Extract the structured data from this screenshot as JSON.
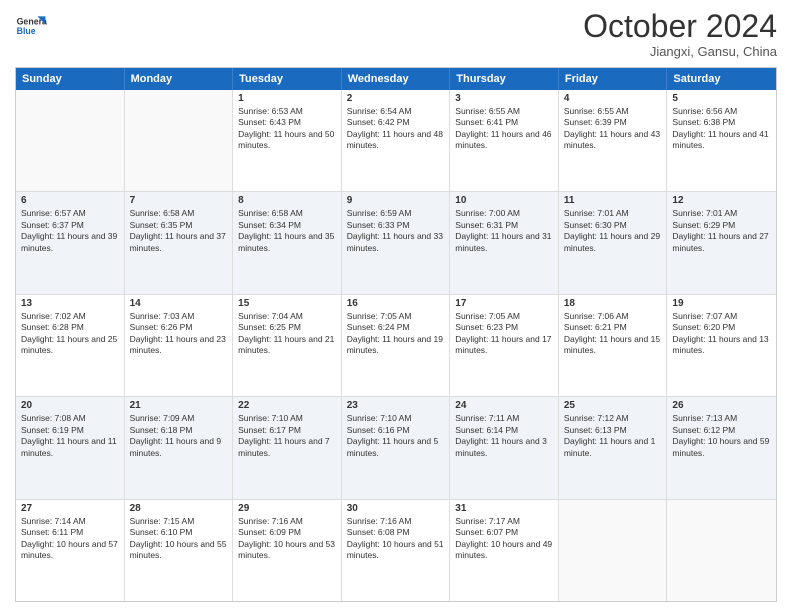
{
  "header": {
    "logo_line1": "General",
    "logo_line2": "Blue",
    "month": "October 2024",
    "location": "Jiangxi, Gansu, China"
  },
  "days_of_week": [
    "Sunday",
    "Monday",
    "Tuesday",
    "Wednesday",
    "Thursday",
    "Friday",
    "Saturday"
  ],
  "weeks": [
    [
      {
        "day": "",
        "sunrise": "",
        "sunset": "",
        "daylight": "",
        "empty": true
      },
      {
        "day": "",
        "sunrise": "",
        "sunset": "",
        "daylight": "",
        "empty": true
      },
      {
        "day": "1",
        "sunrise": "Sunrise: 6:53 AM",
        "sunset": "Sunset: 6:43 PM",
        "daylight": "Daylight: 11 hours and 50 minutes."
      },
      {
        "day": "2",
        "sunrise": "Sunrise: 6:54 AM",
        "sunset": "Sunset: 6:42 PM",
        "daylight": "Daylight: 11 hours and 48 minutes."
      },
      {
        "day": "3",
        "sunrise": "Sunrise: 6:55 AM",
        "sunset": "Sunset: 6:41 PM",
        "daylight": "Daylight: 11 hours and 46 minutes."
      },
      {
        "day": "4",
        "sunrise": "Sunrise: 6:55 AM",
        "sunset": "Sunset: 6:39 PM",
        "daylight": "Daylight: 11 hours and 43 minutes."
      },
      {
        "day": "5",
        "sunrise": "Sunrise: 6:56 AM",
        "sunset": "Sunset: 6:38 PM",
        "daylight": "Daylight: 11 hours and 41 minutes."
      }
    ],
    [
      {
        "day": "6",
        "sunrise": "Sunrise: 6:57 AM",
        "sunset": "Sunset: 6:37 PM",
        "daylight": "Daylight: 11 hours and 39 minutes."
      },
      {
        "day": "7",
        "sunrise": "Sunrise: 6:58 AM",
        "sunset": "Sunset: 6:35 PM",
        "daylight": "Daylight: 11 hours and 37 minutes."
      },
      {
        "day": "8",
        "sunrise": "Sunrise: 6:58 AM",
        "sunset": "Sunset: 6:34 PM",
        "daylight": "Daylight: 11 hours and 35 minutes."
      },
      {
        "day": "9",
        "sunrise": "Sunrise: 6:59 AM",
        "sunset": "Sunset: 6:33 PM",
        "daylight": "Daylight: 11 hours and 33 minutes."
      },
      {
        "day": "10",
        "sunrise": "Sunrise: 7:00 AM",
        "sunset": "Sunset: 6:31 PM",
        "daylight": "Daylight: 11 hours and 31 minutes."
      },
      {
        "day": "11",
        "sunrise": "Sunrise: 7:01 AM",
        "sunset": "Sunset: 6:30 PM",
        "daylight": "Daylight: 11 hours and 29 minutes."
      },
      {
        "day": "12",
        "sunrise": "Sunrise: 7:01 AM",
        "sunset": "Sunset: 6:29 PM",
        "daylight": "Daylight: 11 hours and 27 minutes."
      }
    ],
    [
      {
        "day": "13",
        "sunrise": "Sunrise: 7:02 AM",
        "sunset": "Sunset: 6:28 PM",
        "daylight": "Daylight: 11 hours and 25 minutes."
      },
      {
        "day": "14",
        "sunrise": "Sunrise: 7:03 AM",
        "sunset": "Sunset: 6:26 PM",
        "daylight": "Daylight: 11 hours and 23 minutes."
      },
      {
        "day": "15",
        "sunrise": "Sunrise: 7:04 AM",
        "sunset": "Sunset: 6:25 PM",
        "daylight": "Daylight: 11 hours and 21 minutes."
      },
      {
        "day": "16",
        "sunrise": "Sunrise: 7:05 AM",
        "sunset": "Sunset: 6:24 PM",
        "daylight": "Daylight: 11 hours and 19 minutes."
      },
      {
        "day": "17",
        "sunrise": "Sunrise: 7:05 AM",
        "sunset": "Sunset: 6:23 PM",
        "daylight": "Daylight: 11 hours and 17 minutes."
      },
      {
        "day": "18",
        "sunrise": "Sunrise: 7:06 AM",
        "sunset": "Sunset: 6:21 PM",
        "daylight": "Daylight: 11 hours and 15 minutes."
      },
      {
        "day": "19",
        "sunrise": "Sunrise: 7:07 AM",
        "sunset": "Sunset: 6:20 PM",
        "daylight": "Daylight: 11 hours and 13 minutes."
      }
    ],
    [
      {
        "day": "20",
        "sunrise": "Sunrise: 7:08 AM",
        "sunset": "Sunset: 6:19 PM",
        "daylight": "Daylight: 11 hours and 11 minutes."
      },
      {
        "day": "21",
        "sunrise": "Sunrise: 7:09 AM",
        "sunset": "Sunset: 6:18 PM",
        "daylight": "Daylight: 11 hours and 9 minutes."
      },
      {
        "day": "22",
        "sunrise": "Sunrise: 7:10 AM",
        "sunset": "Sunset: 6:17 PM",
        "daylight": "Daylight: 11 hours and 7 minutes."
      },
      {
        "day": "23",
        "sunrise": "Sunrise: 7:10 AM",
        "sunset": "Sunset: 6:16 PM",
        "daylight": "Daylight: 11 hours and 5 minutes."
      },
      {
        "day": "24",
        "sunrise": "Sunrise: 7:11 AM",
        "sunset": "Sunset: 6:14 PM",
        "daylight": "Daylight: 11 hours and 3 minutes."
      },
      {
        "day": "25",
        "sunrise": "Sunrise: 7:12 AM",
        "sunset": "Sunset: 6:13 PM",
        "daylight": "Daylight: 11 hours and 1 minute."
      },
      {
        "day": "26",
        "sunrise": "Sunrise: 7:13 AM",
        "sunset": "Sunset: 6:12 PM",
        "daylight": "Daylight: 10 hours and 59 minutes."
      }
    ],
    [
      {
        "day": "27",
        "sunrise": "Sunrise: 7:14 AM",
        "sunset": "Sunset: 6:11 PM",
        "daylight": "Daylight: 10 hours and 57 minutes."
      },
      {
        "day": "28",
        "sunrise": "Sunrise: 7:15 AM",
        "sunset": "Sunset: 6:10 PM",
        "daylight": "Daylight: 10 hours and 55 minutes."
      },
      {
        "day": "29",
        "sunrise": "Sunrise: 7:16 AM",
        "sunset": "Sunset: 6:09 PM",
        "daylight": "Daylight: 10 hours and 53 minutes."
      },
      {
        "day": "30",
        "sunrise": "Sunrise: 7:16 AM",
        "sunset": "Sunset: 6:08 PM",
        "daylight": "Daylight: 10 hours and 51 minutes."
      },
      {
        "day": "31",
        "sunrise": "Sunrise: 7:17 AM",
        "sunset": "Sunset: 6:07 PM",
        "daylight": "Daylight: 10 hours and 49 minutes."
      },
      {
        "day": "",
        "sunrise": "",
        "sunset": "",
        "daylight": "",
        "empty": true
      },
      {
        "day": "",
        "sunrise": "",
        "sunset": "",
        "daylight": "",
        "empty": true
      }
    ]
  ]
}
